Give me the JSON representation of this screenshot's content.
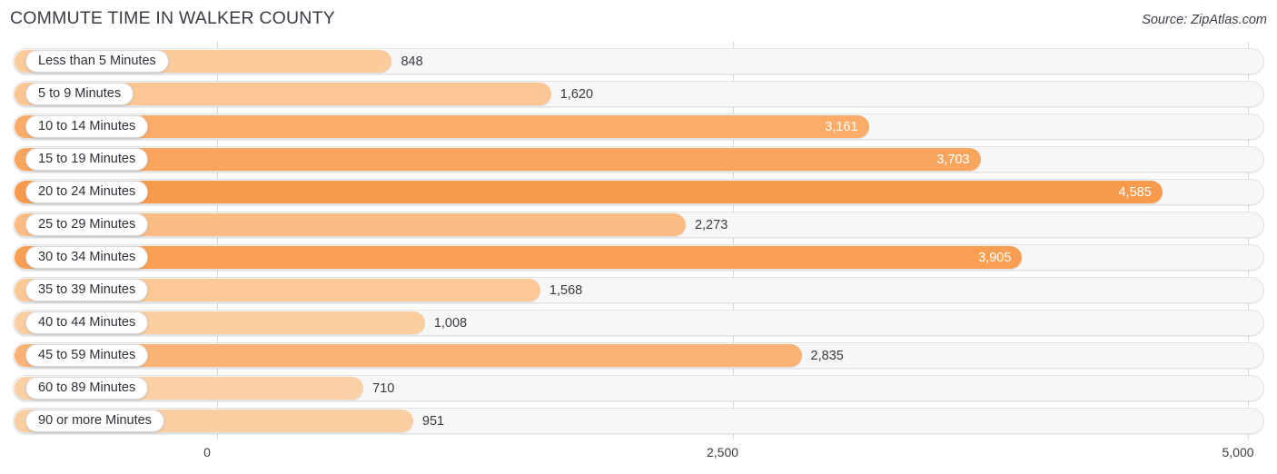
{
  "header": {
    "title": "COMMUTE TIME IN WALKER COUNTY",
    "source": "Source: ZipAtlas.com"
  },
  "chart_data": {
    "type": "bar",
    "orientation": "horizontal",
    "title": "COMMUTE TIME IN WALKER COUNTY",
    "subtitle": "",
    "xlabel": "",
    "ylabel": "",
    "xlim": [
      0,
      5000
    ],
    "grid": true,
    "legend": null,
    "source": "Source: ZipAtlas.com",
    "xticks": [
      "0",
      "2,500",
      "5,000"
    ],
    "xtick_values": [
      0,
      2500,
      5000
    ],
    "categories": [
      "Less than 5 Minutes",
      "5 to 9 Minutes",
      "10 to 14 Minutes",
      "15 to 19 Minutes",
      "20 to 24 Minutes",
      "25 to 29 Minutes",
      "30 to 34 Minutes",
      "35 to 39 Minutes",
      "40 to 44 Minutes",
      "45 to 59 Minutes",
      "60 to 89 Minutes",
      "90 or more Minutes"
    ],
    "values": [
      848,
      1620,
      3161,
      3703,
      4585,
      2273,
      3905,
      1568,
      1008,
      2835,
      710,
      951
    ],
    "value_labels": [
      "848",
      "1,620",
      "3,161",
      "3,703",
      "4,585",
      "2,273",
      "3,905",
      "1,568",
      "1,008",
      "2,835",
      "710",
      "951"
    ],
    "bar_colors": [
      "#fbcb9c",
      "#fbc694",
      "#fcab68",
      "#faa55d",
      "#f79a4c",
      "#fbbc84",
      "#f99f53",
      "#fbc896",
      "#fbcda0",
      "#fab275",
      "#fbd0a4",
      "#fbcea1"
    ],
    "label_inside": [
      false,
      false,
      true,
      true,
      true,
      false,
      true,
      false,
      false,
      false,
      false,
      false
    ]
  },
  "colors": {
    "accent": "#f79a4c",
    "accent_light": "#fbcb9c",
    "track": "#f7f7f7",
    "track_border": "#e3e3e3",
    "grid": "#d8d8d8",
    "text": "#3a3a42"
  }
}
